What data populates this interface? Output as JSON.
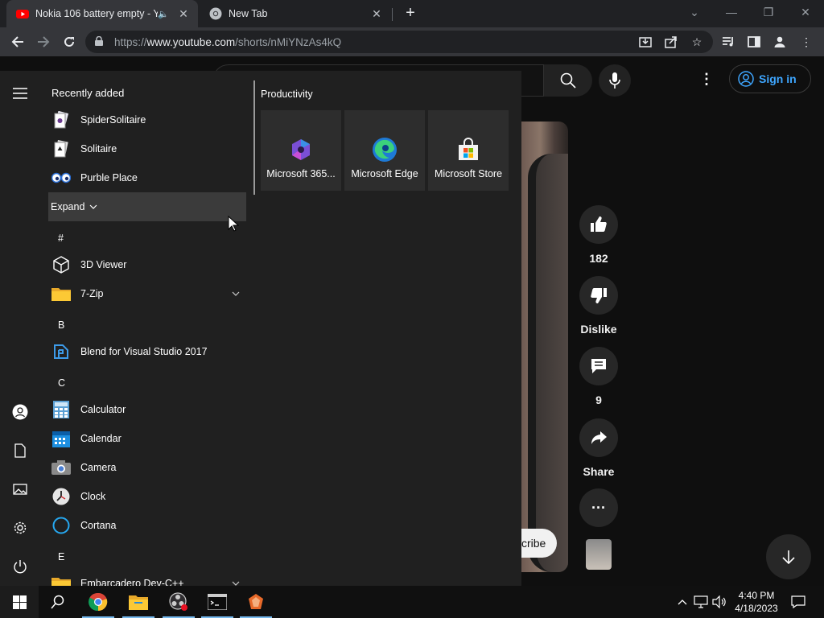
{
  "browser": {
    "tabs": [
      {
        "title": "Nokia 106 battery empty - Yo",
        "icon": "youtube-icon",
        "active": true
      },
      {
        "title": "New Tab",
        "icon": "chrome-icon",
        "active": false
      }
    ],
    "url": {
      "prefix": "https://",
      "host": "www.youtube.com",
      "path": "/shorts/nMiYNzAs4kQ"
    }
  },
  "youtube": {
    "sign_in": "Sign in",
    "subscribe_partial": "cribe",
    "actions": [
      {
        "name": "like",
        "label": "182"
      },
      {
        "name": "dislike",
        "label": "Dislike"
      },
      {
        "name": "comments",
        "label": "9"
      },
      {
        "name": "share",
        "label": "Share"
      },
      {
        "name": "more",
        "label": ""
      }
    ]
  },
  "start_menu": {
    "recently_added_title": "Recently added",
    "recently_added": [
      {
        "label": "SpiderSolitaire",
        "icon": "spider-solitaire-icon"
      },
      {
        "label": "Solitaire",
        "icon": "solitaire-icon"
      },
      {
        "label": "Purble Place",
        "icon": "purble-place-icon"
      }
    ],
    "expand_label": "Expand",
    "groups": [
      {
        "letter": "#",
        "apps": [
          {
            "label": "3D Viewer",
            "icon": "3d-viewer-icon"
          },
          {
            "label": "7-Zip",
            "icon": "folder-icon",
            "expandable": true
          }
        ]
      },
      {
        "letter": "B",
        "apps": [
          {
            "label": "Blend for Visual Studio 2017",
            "icon": "blend-icon"
          }
        ]
      },
      {
        "letter": "C",
        "apps": [
          {
            "label": "Calculator",
            "icon": "calculator-icon"
          },
          {
            "label": "Calendar",
            "icon": "calendar-icon"
          },
          {
            "label": "Camera",
            "icon": "camera-icon"
          },
          {
            "label": "Clock",
            "icon": "clock-icon"
          },
          {
            "label": "Cortana",
            "icon": "cortana-icon"
          }
        ]
      },
      {
        "letter": "E",
        "apps": [
          {
            "label": "Embarcadero Dev-C++",
            "icon": "folder-icon",
            "expandable": true
          }
        ]
      }
    ],
    "productivity_title": "Productivity",
    "tiles": [
      {
        "label": "Microsoft 365...",
        "icon": "microsoft-365-icon"
      },
      {
        "label": "Microsoft Edge",
        "icon": "edge-icon"
      },
      {
        "label": "Microsoft Store",
        "icon": "store-icon"
      }
    ]
  },
  "taskbar": {
    "time": "4:40 PM",
    "date": "4/18/2023"
  }
}
